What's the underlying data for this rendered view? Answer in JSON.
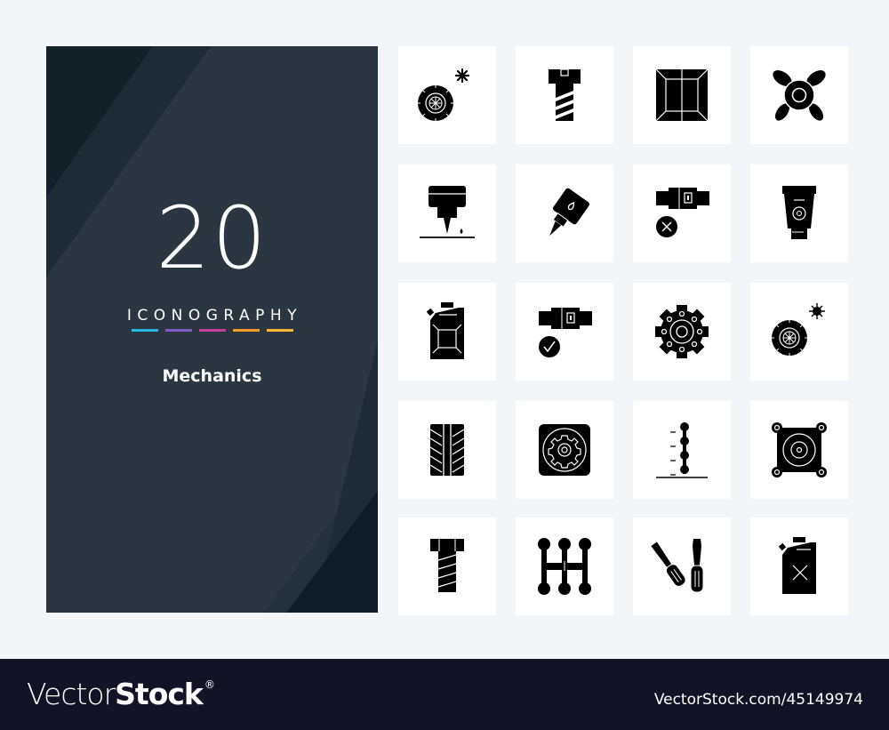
{
  "cover": {
    "count": "20",
    "kicker": "ICONOGRAPHY",
    "subject": "Mechanics",
    "accent_bars": [
      "#2bb7e4",
      "#7c5cc8",
      "#c63c9a",
      "#f39a2c",
      "#f7b733"
    ],
    "background": "#2b3640"
  },
  "icons": [
    {
      "name": "tire-snowflake-icon",
      "label": "tire with snowflake"
    },
    {
      "name": "screw-bolt-icon",
      "label": "screw bolt"
    },
    {
      "name": "box-crate-icon",
      "label": "box crate"
    },
    {
      "name": "propeller-fan-icon",
      "label": "propeller fan"
    },
    {
      "name": "cnc-drill-icon",
      "label": "cnc drill"
    },
    {
      "name": "oil-gun-icon",
      "label": "oil gun"
    },
    {
      "name": "seatbelt-cross-icon",
      "label": "seatbelt unfastened"
    },
    {
      "name": "cream-tube-icon",
      "label": "tube"
    },
    {
      "name": "jerrycan-icon",
      "label": "jerrycan"
    },
    {
      "name": "seatbelt-check-icon",
      "label": "seatbelt fastened"
    },
    {
      "name": "gear-icon",
      "label": "gear"
    },
    {
      "name": "tire-sun-icon",
      "label": "tire with sun"
    },
    {
      "name": "tire-tread-icon",
      "label": "tire tread"
    },
    {
      "name": "gear-panel-icon",
      "label": "gear panel"
    },
    {
      "name": "suspension-height-icon",
      "label": "suspension height"
    },
    {
      "name": "speaker-mount-icon",
      "label": "speaker mount"
    },
    {
      "name": "bolt-icon",
      "label": "bolt"
    },
    {
      "name": "gear-shifter-icon",
      "label": "gear shifter"
    },
    {
      "name": "screwdrivers-icon",
      "label": "screwdrivers"
    },
    {
      "name": "jerrycan-empty-icon",
      "label": "jerrycan empty"
    }
  ],
  "footer": {
    "brand_light": "Vector",
    "brand_bold": "Stock",
    "brand_mark": "®",
    "url": "VectorStock.com/45149974"
  }
}
